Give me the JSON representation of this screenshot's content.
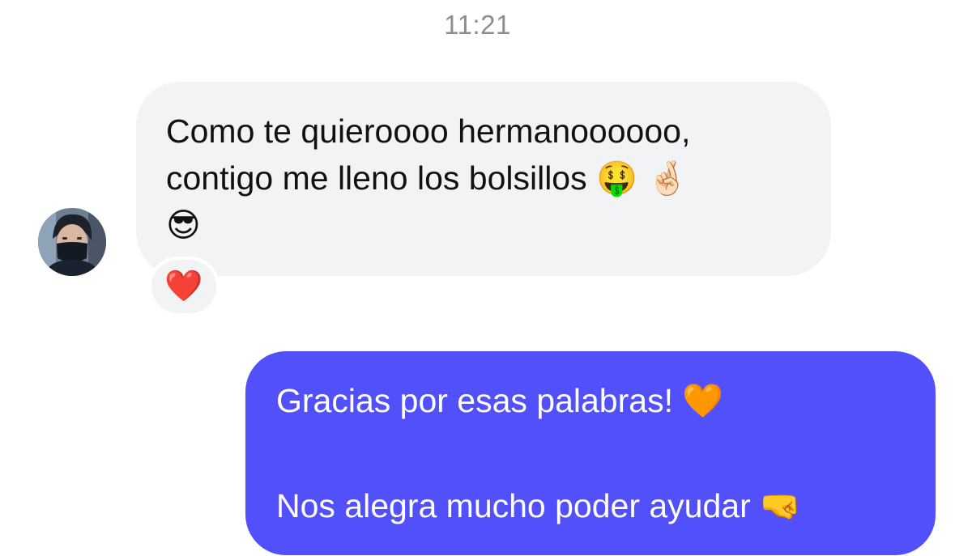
{
  "timestamp": "11:21",
  "incoming": {
    "avatar_icon": "user-avatar-masked-person",
    "text": "Como te quieroooo hermanoooooo,\ncontigo me lleno los bolsillos 🤑 🤞🏻\n😎",
    "reaction": "❤️"
  },
  "outgoing": {
    "line1": "Gracias por esas palabras! 🧡",
    "line2": "Nos alegra mucho poder ayudar 🤜"
  },
  "colors": {
    "incoming_bubble": "#f2f3f5",
    "outgoing_bubble": "#5150fa",
    "timestamp": "#8a8d93"
  }
}
